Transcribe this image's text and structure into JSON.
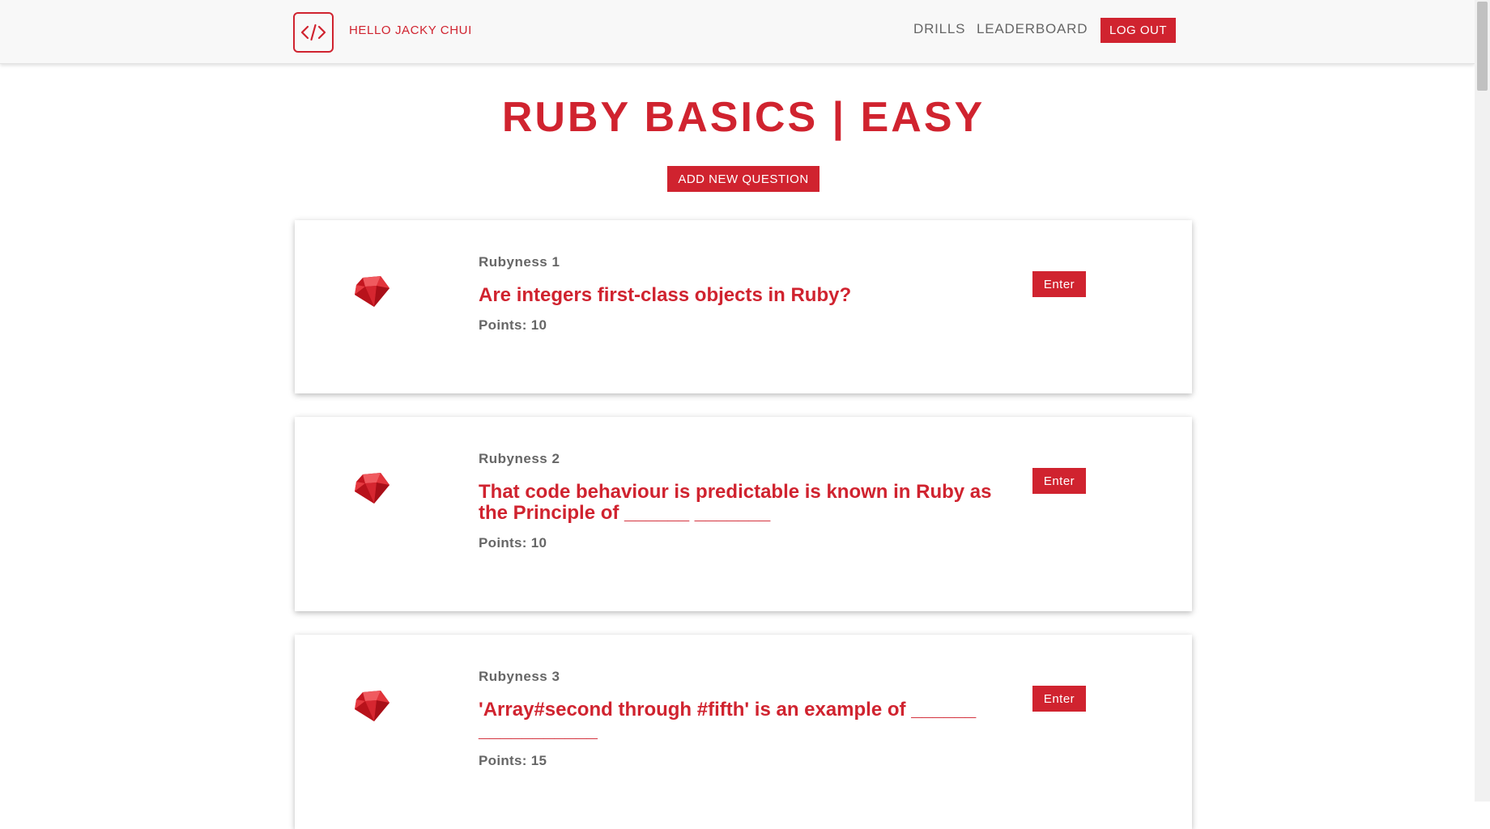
{
  "header": {
    "greeting": "HELLO JACKY CHUI",
    "logo_icon": "code-brackets-icon",
    "nav": [
      {
        "label": "DRILLS"
      },
      {
        "label": "LEADERBOARD"
      }
    ],
    "logout_label": "LOG OUT"
  },
  "main": {
    "title": "RUBY BASICS | EASY",
    "add_button_label": "ADD NEW QUESTION",
    "questions": [
      {
        "name": "Rubyness 1",
        "text": "Are integers first-class objects in Ruby?",
        "points": "Points: 10",
        "enter_label": "Enter",
        "icon": "ruby-gem-icon"
      },
      {
        "name": "Rubyness 2",
        "text": "That code behaviour is predictable is known in Ruby as the Principle of ______ _______",
        "points": "Points: 10",
        "enter_label": "Enter",
        "icon": "ruby-gem-icon"
      },
      {
        "name": "Rubyness 3",
        "text": "'Array#second through #fifth' is an example of ______ ___________",
        "points": "Points: 15",
        "enter_label": "Enter",
        "icon": "ruby-gem-icon"
      }
    ]
  },
  "colors": {
    "accent": "#d0232f",
    "muted_text": "#666666",
    "navbar_bg": "#f8f8f8"
  }
}
